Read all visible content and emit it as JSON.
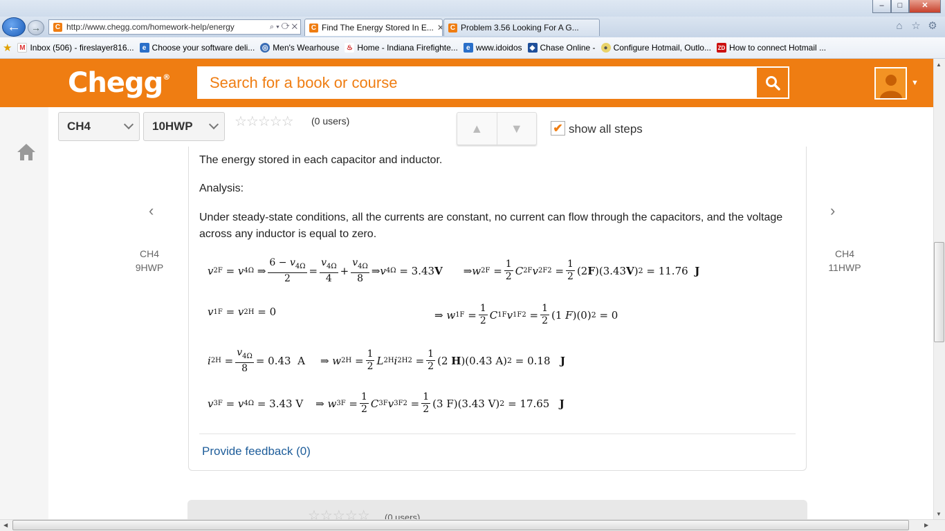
{
  "browser": {
    "address": "http://www.chegg.com/homework-help/energy",
    "tabs": [
      {
        "label": "Find The Energy Stored In E..."
      },
      {
        "label": "Problem 3.56 Looking For A G..."
      }
    ],
    "favorites": [
      {
        "label": "Inbox (506) - fireslayer816...",
        "icon": "gmail-icon"
      },
      {
        "label": "Choose your software deli...",
        "icon": "ie-page-icon"
      },
      {
        "label": "Men's Wearhouse",
        "icon": "globe-icon"
      },
      {
        "label": "Home - Indiana Firefighte...",
        "icon": "flame-icon"
      },
      {
        "label": "www.idoidos",
        "icon": "ie-page-icon"
      },
      {
        "label": "Chase Online -",
        "icon": "chase-icon"
      },
      {
        "label": "Configure Hotmail, Outlo...",
        "icon": "cd-icon"
      },
      {
        "label": "How to connect Hotmail ...",
        "icon": "zd-icon"
      }
    ]
  },
  "header": {
    "logo": "Chegg",
    "search_placeholder": "Search for a book or course"
  },
  "toolbar": {
    "chapter": "CH4",
    "problem": "10HWP",
    "rating_users": "(0 users)",
    "show_all_steps": "show all steps"
  },
  "nav": {
    "prev_chapter": "CH4",
    "prev_problem": "9HWP",
    "next_chapter": "CH4",
    "next_problem": "11HWP"
  },
  "content": {
    "p1": "The energy stored in each capacitor and inductor.",
    "p2": "Analysis:",
    "p3": "Under steady-state conditions, all the currents are constant, no current can flow through the capacitors, and the voltage across any inductor is equal to zero.",
    "feedback": "Provide feedback (0)",
    "next_rating_users": "(0 users)"
  },
  "colors": {
    "brand": "#ef7d12",
    "link": "#1e5d9a"
  }
}
